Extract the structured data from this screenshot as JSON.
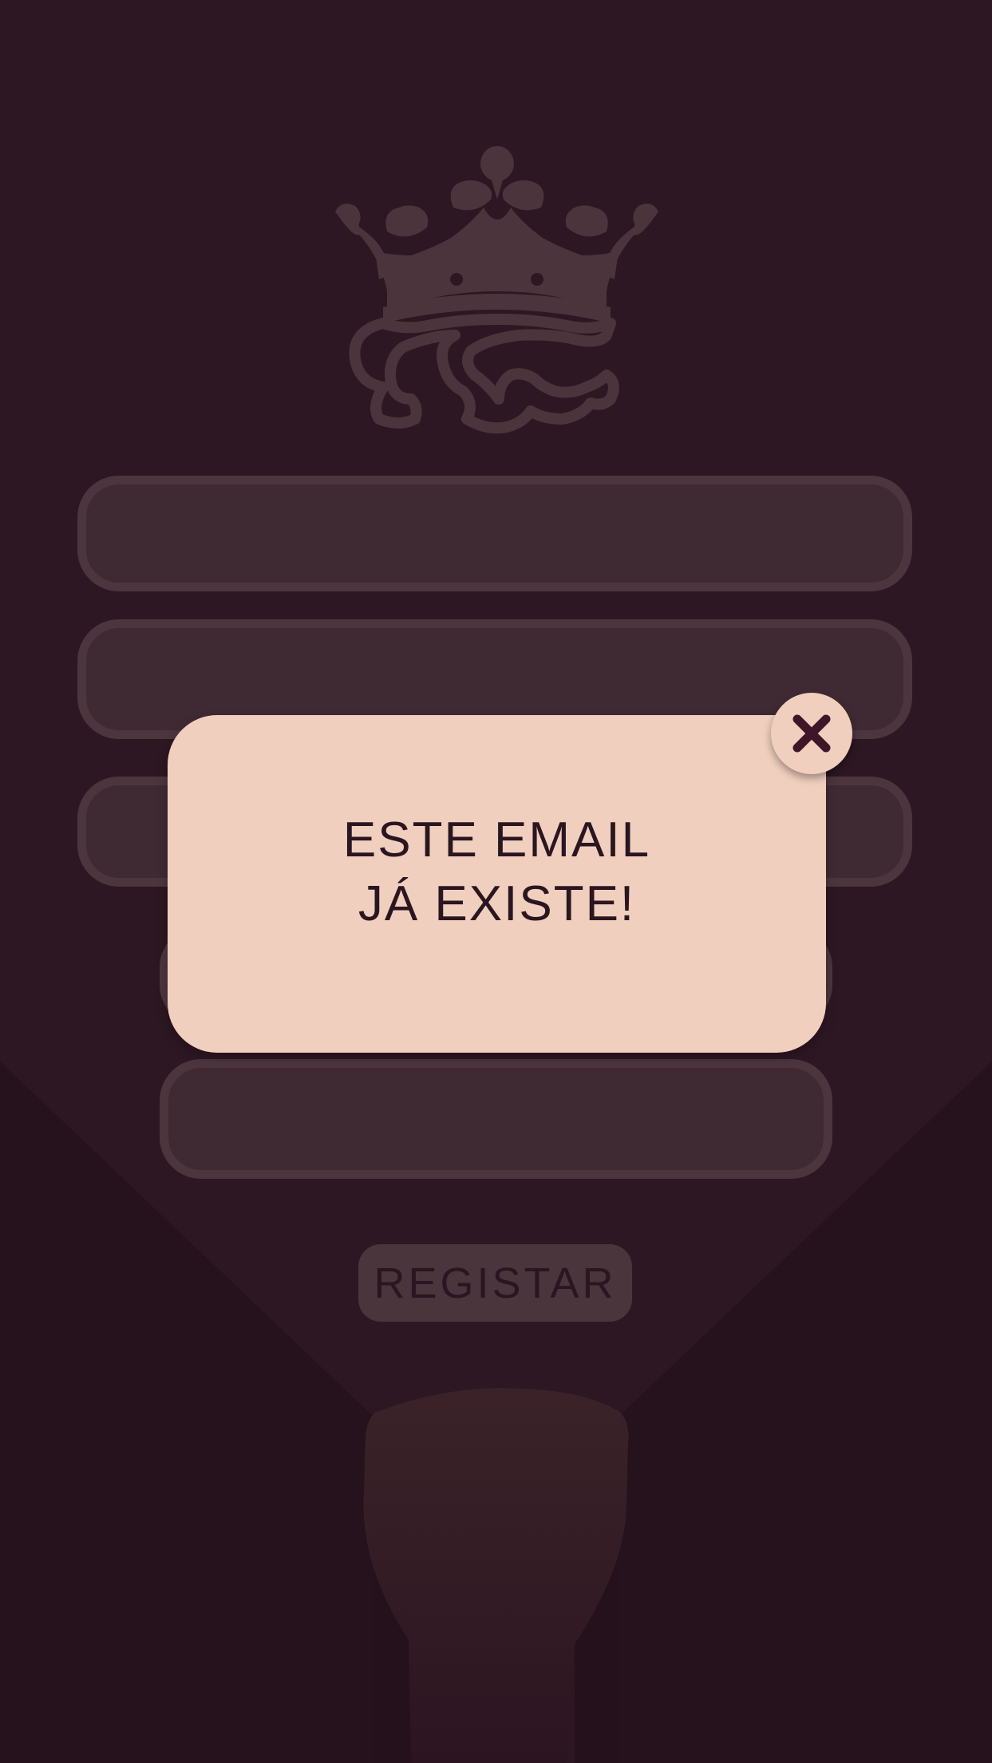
{
  "form": {
    "fields": [
      {
        "value": "",
        "placeholder": ""
      },
      {
        "value": "",
        "placeholder": ""
      },
      {
        "value": "",
        "placeholder": ""
      },
      {
        "value": "",
        "placeholder": ""
      },
      {
        "value": "",
        "placeholder": ""
      }
    ],
    "register_label": "REGISTAR"
  },
  "modal": {
    "line1": "ESTE EMAIL",
    "line2": "JÁ EXISTE!",
    "close_icon": "close-icon"
  },
  "colors": {
    "background": "#2d1722",
    "field_fill": "#3f2a33",
    "field_border": "#4d353d",
    "modal_fill": "#f0cfbe",
    "text_dark": "#2a1620",
    "accent_dark": "#3e1628"
  }
}
